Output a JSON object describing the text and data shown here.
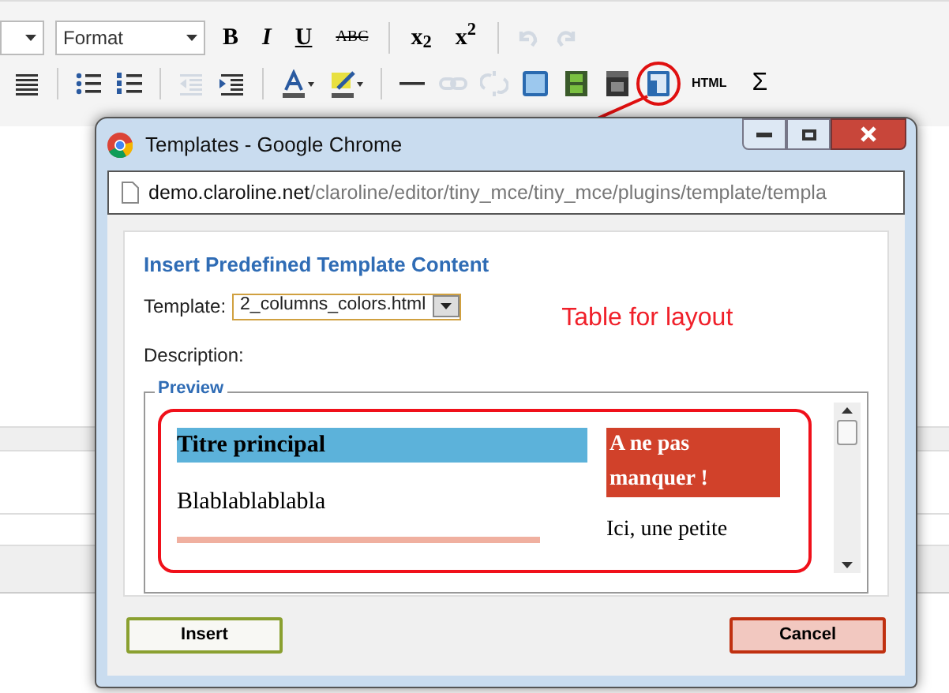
{
  "toolbar": {
    "format_select": {
      "value": "Format"
    },
    "row1": [
      {
        "kind": "text",
        "label": "B"
      },
      {
        "kind": "text",
        "label": "I"
      },
      {
        "kind": "text",
        "label": "U"
      },
      {
        "kind": "text",
        "label": "ABC"
      },
      {
        "kind": "sep"
      },
      {
        "kind": "text",
        "label": "x$_{2}$"
      },
      {
        "kind": "text",
        "label": "x$^{2}$"
      },
      {
        "kind": "sep"
      },
      {
        "kind": "icon",
        "disabled": true
      },
      {
        "kind": "icon",
        "disabled": true
      }
    ],
    "row2": [
      {
        "kind": "icon",
        "disabled": false
      },
      {
        "kind": "sep"
      },
      {
        "kind": "icon",
        "disabled": false
      },
      {
        "kind": "icon",
        "disabled": false
      },
      {
        "kind": "sep"
      },
      {
        "kind": "icon",
        "disabled": true
      },
      {
        "kind": "icon",
        "disabled": false
      },
      {
        "kind": "sep"
      },
      {
        "kind": "icon",
        "disabled": false
      },
      {
        "kind": "icon",
        "disabled": false
      },
      {
        "kind": "sep"
      },
      {
        "kind": "icon",
        "disabled": false
      },
      {
        "kind": "icon",
        "disabled": true
      },
      {
        "kind": "icon",
        "disabled": true
      },
      {
        "kind": "icon",
        "disabled": false
      },
      {
        "kind": "icon",
        "disabled": false
      },
      {
        "kind": "icon",
        "disabled": false
      },
      {
        "kind": "icon",
        "disabled": false
      },
      {
        "kind": "text",
        "label": "HTML"
      },
      {
        "kind": "text",
        "label": "Σ"
      }
    ]
  },
  "dialog": {
    "title": "Templates - Google Chrome",
    "url_host": "demo.claroline.net",
    "url_path": "/claroline/editor/tiny_mce/tiny_mce/plugins/template/templa",
    "heading": "Insert Predefined Template Content",
    "template_label": "Template:",
    "template_value": "2_columns_colors.html",
    "description_label": "Description:",
    "annotation": "Table for layout",
    "preview_legend": "Preview",
    "preview": {
      "title": "Titre principal",
      "body": "Blablablablabla",
      "aside_title": "A ne pas manquer !",
      "aside_body": "Ici, une petite"
    },
    "buttons": [
      {
        "label": "Insert",
        "kind": "insert"
      },
      {
        "label": "Cancel",
        "kind": "cancel"
      }
    ]
  }
}
